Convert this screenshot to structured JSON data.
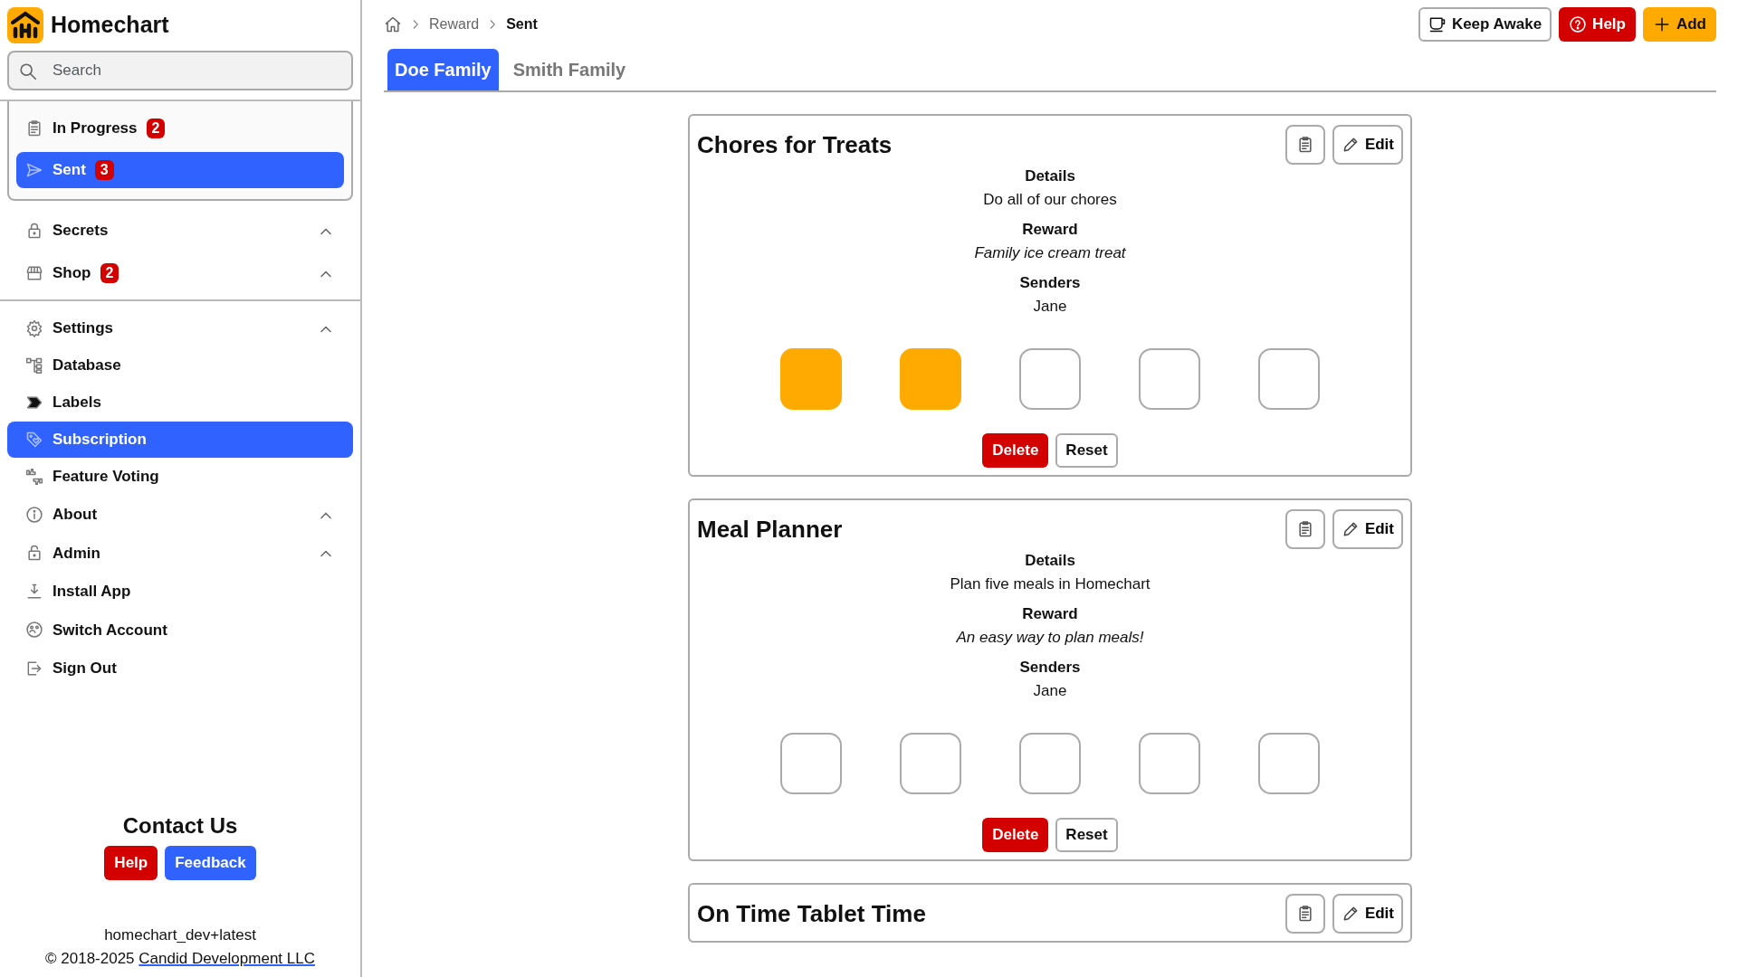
{
  "app": {
    "name": "Homechart"
  },
  "search": {
    "placeholder": "Search"
  },
  "sidebar": {
    "submenu": [
      {
        "label": "In Progress",
        "badge": "2",
        "selected": false
      },
      {
        "label": "Sent",
        "badge": "3",
        "selected": true
      }
    ],
    "sections": [
      [
        {
          "label": "Secrets",
          "kind": "collapsible",
          "selected": false
        },
        {
          "label": "Shop",
          "badge": "2",
          "kind": "collapsible",
          "selected": false
        }
      ],
      [
        {
          "label": "Settings",
          "kind": "collapsible",
          "selected": false
        },
        {
          "label": "Database",
          "kind": "link",
          "selected": false
        },
        {
          "label": "Labels",
          "kind": "link",
          "selected": false
        },
        {
          "label": "Subscription",
          "kind": "link",
          "selected": true
        },
        {
          "label": "Feature Voting",
          "kind": "link",
          "selected": false
        },
        {
          "label": "About",
          "kind": "collapsible",
          "selected": false
        },
        {
          "label": "Admin",
          "kind": "collapsible",
          "selected": false
        },
        {
          "label": "Install App",
          "kind": "link",
          "selected": false
        },
        {
          "label": "Switch Account",
          "kind": "link",
          "selected": false
        },
        {
          "label": "Sign Out",
          "kind": "link",
          "selected": false
        }
      ]
    ]
  },
  "contact": {
    "title": "Contact Us",
    "buttons": [
      {
        "label": "Help",
        "kind": "danger"
      },
      {
        "label": "Feedback",
        "kind": "primary"
      }
    ],
    "version": "homechart_dev+latest",
    "copyright": "© 2018-2025 ",
    "company_link": "Candid Development LLC"
  },
  "breadcrumb": [
    "Reward",
    "Sent"
  ],
  "header_buttons": [
    {
      "label": "Keep Awake",
      "kind": "outline"
    },
    {
      "label": "Help",
      "kind": "danger"
    },
    {
      "label": "Add",
      "kind": "warning"
    }
  ],
  "tabs": [
    {
      "label": "Doe Family",
      "selected": true
    },
    {
      "label": "Smith Family",
      "selected": false
    }
  ],
  "cards": [
    {
      "title": "Chores for Treats",
      "edit": "Edit",
      "fields": [
        {
          "label": "Details",
          "value": "Do all of our chores",
          "kind": "plain"
        },
        {
          "label": "Reward",
          "value": "Family ice cream treat",
          "kind": "italic"
        },
        {
          "label": "Senders",
          "value": "Jane",
          "kind": "plain"
        }
      ],
      "slots": [
        {
          "filled": true
        },
        {
          "filled": true
        },
        {
          "filled": false
        },
        {
          "filled": false
        },
        {
          "filled": false
        }
      ],
      "buttons": [
        {
          "label": "Delete",
          "kind": "danger"
        },
        {
          "label": "Reset",
          "kind": "outline"
        }
      ]
    },
    {
      "title": "Meal Planner",
      "edit": "Edit",
      "fields": [
        {
          "label": "Details",
          "value": "Plan five meals in Homechart",
          "kind": "plain"
        },
        {
          "label": "Reward",
          "value": "An easy way to plan meals!",
          "kind": "italic"
        },
        {
          "label": "Senders",
          "value": "Jane",
          "kind": "plain"
        }
      ],
      "slots": [
        {
          "filled": false
        },
        {
          "filled": false
        },
        {
          "filled": false
        },
        {
          "filled": false
        },
        {
          "filled": false
        }
      ],
      "buttons": [
        {
          "label": "Delete",
          "kind": "danger"
        },
        {
          "label": "Reset",
          "kind": "outline"
        }
      ]
    },
    {
      "title": "On Time Tablet Time",
      "edit": "Edit"
    }
  ]
}
